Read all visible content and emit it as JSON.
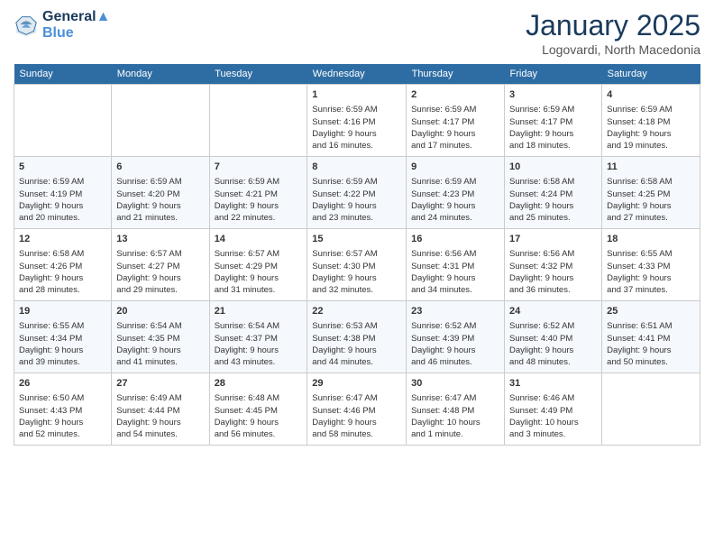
{
  "header": {
    "logo_line1": "General",
    "logo_line2": "Blue",
    "month": "January 2025",
    "location": "Logovardi, North Macedonia"
  },
  "weekdays": [
    "Sunday",
    "Monday",
    "Tuesday",
    "Wednesday",
    "Thursday",
    "Friday",
    "Saturday"
  ],
  "weeks": [
    [
      {
        "day": "",
        "text": ""
      },
      {
        "day": "",
        "text": ""
      },
      {
        "day": "",
        "text": ""
      },
      {
        "day": "1",
        "text": "Sunrise: 6:59 AM\nSunset: 4:16 PM\nDaylight: 9 hours\nand 16 minutes."
      },
      {
        "day": "2",
        "text": "Sunrise: 6:59 AM\nSunset: 4:17 PM\nDaylight: 9 hours\nand 17 minutes."
      },
      {
        "day": "3",
        "text": "Sunrise: 6:59 AM\nSunset: 4:17 PM\nDaylight: 9 hours\nand 18 minutes."
      },
      {
        "day": "4",
        "text": "Sunrise: 6:59 AM\nSunset: 4:18 PM\nDaylight: 9 hours\nand 19 minutes."
      }
    ],
    [
      {
        "day": "5",
        "text": "Sunrise: 6:59 AM\nSunset: 4:19 PM\nDaylight: 9 hours\nand 20 minutes."
      },
      {
        "day": "6",
        "text": "Sunrise: 6:59 AM\nSunset: 4:20 PM\nDaylight: 9 hours\nand 21 minutes."
      },
      {
        "day": "7",
        "text": "Sunrise: 6:59 AM\nSunset: 4:21 PM\nDaylight: 9 hours\nand 22 minutes."
      },
      {
        "day": "8",
        "text": "Sunrise: 6:59 AM\nSunset: 4:22 PM\nDaylight: 9 hours\nand 23 minutes."
      },
      {
        "day": "9",
        "text": "Sunrise: 6:59 AM\nSunset: 4:23 PM\nDaylight: 9 hours\nand 24 minutes."
      },
      {
        "day": "10",
        "text": "Sunrise: 6:58 AM\nSunset: 4:24 PM\nDaylight: 9 hours\nand 25 minutes."
      },
      {
        "day": "11",
        "text": "Sunrise: 6:58 AM\nSunset: 4:25 PM\nDaylight: 9 hours\nand 27 minutes."
      }
    ],
    [
      {
        "day": "12",
        "text": "Sunrise: 6:58 AM\nSunset: 4:26 PM\nDaylight: 9 hours\nand 28 minutes."
      },
      {
        "day": "13",
        "text": "Sunrise: 6:57 AM\nSunset: 4:27 PM\nDaylight: 9 hours\nand 29 minutes."
      },
      {
        "day": "14",
        "text": "Sunrise: 6:57 AM\nSunset: 4:29 PM\nDaylight: 9 hours\nand 31 minutes."
      },
      {
        "day": "15",
        "text": "Sunrise: 6:57 AM\nSunset: 4:30 PM\nDaylight: 9 hours\nand 32 minutes."
      },
      {
        "day": "16",
        "text": "Sunrise: 6:56 AM\nSunset: 4:31 PM\nDaylight: 9 hours\nand 34 minutes."
      },
      {
        "day": "17",
        "text": "Sunrise: 6:56 AM\nSunset: 4:32 PM\nDaylight: 9 hours\nand 36 minutes."
      },
      {
        "day": "18",
        "text": "Sunrise: 6:55 AM\nSunset: 4:33 PM\nDaylight: 9 hours\nand 37 minutes."
      }
    ],
    [
      {
        "day": "19",
        "text": "Sunrise: 6:55 AM\nSunset: 4:34 PM\nDaylight: 9 hours\nand 39 minutes."
      },
      {
        "day": "20",
        "text": "Sunrise: 6:54 AM\nSunset: 4:35 PM\nDaylight: 9 hours\nand 41 minutes."
      },
      {
        "day": "21",
        "text": "Sunrise: 6:54 AM\nSunset: 4:37 PM\nDaylight: 9 hours\nand 43 minutes."
      },
      {
        "day": "22",
        "text": "Sunrise: 6:53 AM\nSunset: 4:38 PM\nDaylight: 9 hours\nand 44 minutes."
      },
      {
        "day": "23",
        "text": "Sunrise: 6:52 AM\nSunset: 4:39 PM\nDaylight: 9 hours\nand 46 minutes."
      },
      {
        "day": "24",
        "text": "Sunrise: 6:52 AM\nSunset: 4:40 PM\nDaylight: 9 hours\nand 48 minutes."
      },
      {
        "day": "25",
        "text": "Sunrise: 6:51 AM\nSunset: 4:41 PM\nDaylight: 9 hours\nand 50 minutes."
      }
    ],
    [
      {
        "day": "26",
        "text": "Sunrise: 6:50 AM\nSunset: 4:43 PM\nDaylight: 9 hours\nand 52 minutes."
      },
      {
        "day": "27",
        "text": "Sunrise: 6:49 AM\nSunset: 4:44 PM\nDaylight: 9 hours\nand 54 minutes."
      },
      {
        "day": "28",
        "text": "Sunrise: 6:48 AM\nSunset: 4:45 PM\nDaylight: 9 hours\nand 56 minutes."
      },
      {
        "day": "29",
        "text": "Sunrise: 6:47 AM\nSunset: 4:46 PM\nDaylight: 9 hours\nand 58 minutes."
      },
      {
        "day": "30",
        "text": "Sunrise: 6:47 AM\nSunset: 4:48 PM\nDaylight: 10 hours\nand 1 minute."
      },
      {
        "day": "31",
        "text": "Sunrise: 6:46 AM\nSunset: 4:49 PM\nDaylight: 10 hours\nand 3 minutes."
      },
      {
        "day": "",
        "text": ""
      }
    ]
  ]
}
